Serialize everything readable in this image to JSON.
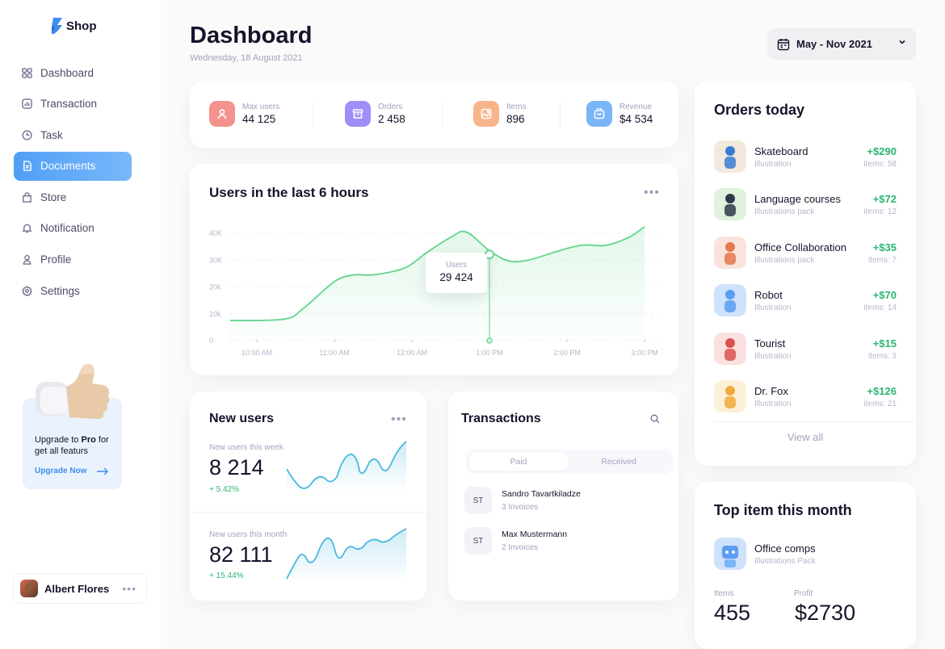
{
  "sidebar": {
    "logo_text": "Shop",
    "nav": [
      {
        "label": "Dashboard",
        "icon": "grid-icon"
      },
      {
        "label": "Transaction",
        "icon": "chart-icon"
      },
      {
        "label": "Task",
        "icon": "clock-icon"
      },
      {
        "label": "Documents",
        "icon": "document-icon",
        "active": true
      },
      {
        "label": "Store",
        "icon": "store-icon"
      },
      {
        "label": "Notification",
        "icon": "bell-icon"
      },
      {
        "label": "Profile",
        "icon": "user-icon"
      },
      {
        "label": "Settings",
        "icon": "gear-icon"
      }
    ],
    "upgrade": {
      "line1": "Upgrade to ",
      "bold": "Pro",
      "line1_rest": " for",
      "line2": "get all featurs",
      "link": "Upgrade Now"
    },
    "user": {
      "name": "Albert Flores",
      "more": "•••"
    }
  },
  "header": {
    "title": "Dashboard",
    "date": "Wednesday, 18 August 2021",
    "date_range": "May - Nov 2021"
  },
  "stats": [
    {
      "label": "Max users",
      "value": "44 125",
      "color": "#f4938e",
      "icon": "user-icon"
    },
    {
      "label": "Orders",
      "value": "2 458",
      "color": "#a18df7",
      "icon": "archive-icon"
    },
    {
      "label": "Items",
      "value": "896",
      "color": "#f8b48a",
      "icon": "image-icon"
    },
    {
      "label": "Revenue",
      "value": "$4 534",
      "color": "#7ab5f8",
      "icon": "bag-icon"
    }
  ],
  "users_chart": {
    "title": "Users in the last 6 hours",
    "more": "•••",
    "tooltip_label": "Users",
    "tooltip_value": "29 424"
  },
  "chart_data": {
    "type": "area",
    "y_ticks": [
      "40K",
      "30K",
      "20k",
      "10k",
      "0"
    ],
    "x_ticks": [
      "10:00 AM",
      "11:00 AM",
      "12:00 AM",
      "1:00 PM",
      "2:00 PM",
      "3:00 PM"
    ],
    "ylim": [
      0,
      40000
    ],
    "highlight": {
      "x": "1:00 PM",
      "label": "Users",
      "value": 29424
    },
    "series": [
      {
        "color": "#5fd58a",
        "x": [
          0,
          0.35,
          0.6,
          1.0,
          1.25,
          1.5,
          1.9,
          2.2,
          2.5,
          2.7,
          3.0,
          3.25,
          3.5,
          3.9,
          4.2,
          4.5,
          4.8,
          5.0
        ],
        "values": [
          7500,
          8000,
          12000,
          22000,
          24500,
          24500,
          27000,
          33000,
          38500,
          40500,
          33500,
          29700,
          30000,
          33500,
          35600,
          35500,
          38500,
          42500
        ]
      }
    ]
  },
  "new_users": {
    "title": "New users",
    "more": "•••",
    "week": {
      "label": "New users this week",
      "value": "8 214",
      "growth": "+ 5.42%"
    },
    "month": {
      "label": "New users this month",
      "value": "82 111",
      "growth": "+ 15.44%"
    }
  },
  "transactions": {
    "title": "Transactions",
    "tabs": [
      "Paid",
      "Received"
    ],
    "rows": [
      {
        "initials": "ST",
        "name": "Sandro Tavartkiladze",
        "sub": "3 Invoices"
      },
      {
        "initials": "ST",
        "name": "Max Mustermann",
        "sub": "2 Invoices"
      }
    ]
  },
  "orders": {
    "title": "Orders today",
    "view_all": "View all",
    "rows": [
      {
        "name": "Skateboard",
        "type": "Illustration",
        "price": "+$290",
        "items": "items: 58",
        "color": "#f2e9dc"
      },
      {
        "name": "Language courses",
        "type": "Illustrations pack",
        "price": "+$72",
        "items": "items: 12",
        "color": "#dff2dc"
      },
      {
        "name": "Office Collaboration",
        "type": "Illustrations pack",
        "price": "+$35",
        "items": "items: 7",
        "color": "#f9e4dc"
      },
      {
        "name": "Robot",
        "type": "Illustration",
        "price": "+$70",
        "items": "items: 14",
        "color": "#cfe2fb"
      },
      {
        "name": "Tourist",
        "type": "Illustration",
        "price": "+$15",
        "items": "items: 3",
        "color": "#fbe0e0"
      },
      {
        "name": "Dr. Fox",
        "type": "Illustration",
        "price": "+$126",
        "items": "items: 21",
        "color": "#fdf0d8"
      }
    ]
  },
  "top_item": {
    "title": "Top item this month",
    "name": "Office comps",
    "type": "Illustrations Pack",
    "items_label": "Items",
    "items_value": "455",
    "profit_label": "Profit",
    "profit_value": "$2730"
  }
}
